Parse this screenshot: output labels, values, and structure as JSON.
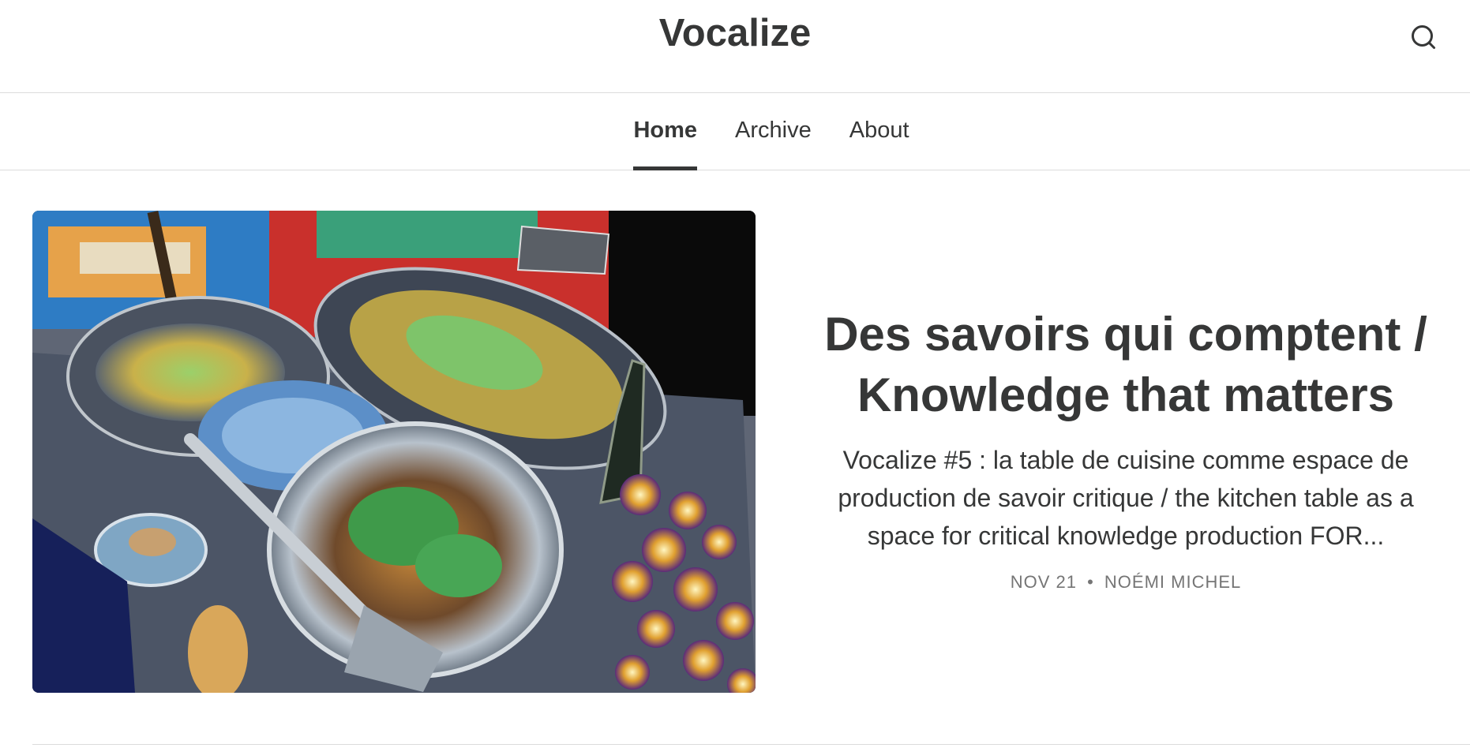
{
  "header": {
    "site_title": "Vocalize",
    "search_icon": "search-icon"
  },
  "nav": {
    "tabs": [
      {
        "label": "Home",
        "active": true
      },
      {
        "label": "Archive",
        "active": false
      },
      {
        "label": "About",
        "active": false
      }
    ]
  },
  "featured_post": {
    "image_alt": "Food dishes on a kitchen table (inverted colors)",
    "title": "Des savoirs qui comptent / Knowledge that matters",
    "subtitle": "Vocalize #5 : la table de cuisine comme espace de production de savoir critique / the kitchen table as a space for critical knowledge production FOR...",
    "date": "NOV 21",
    "separator": "•",
    "author": "NOÉMI MICHEL"
  }
}
